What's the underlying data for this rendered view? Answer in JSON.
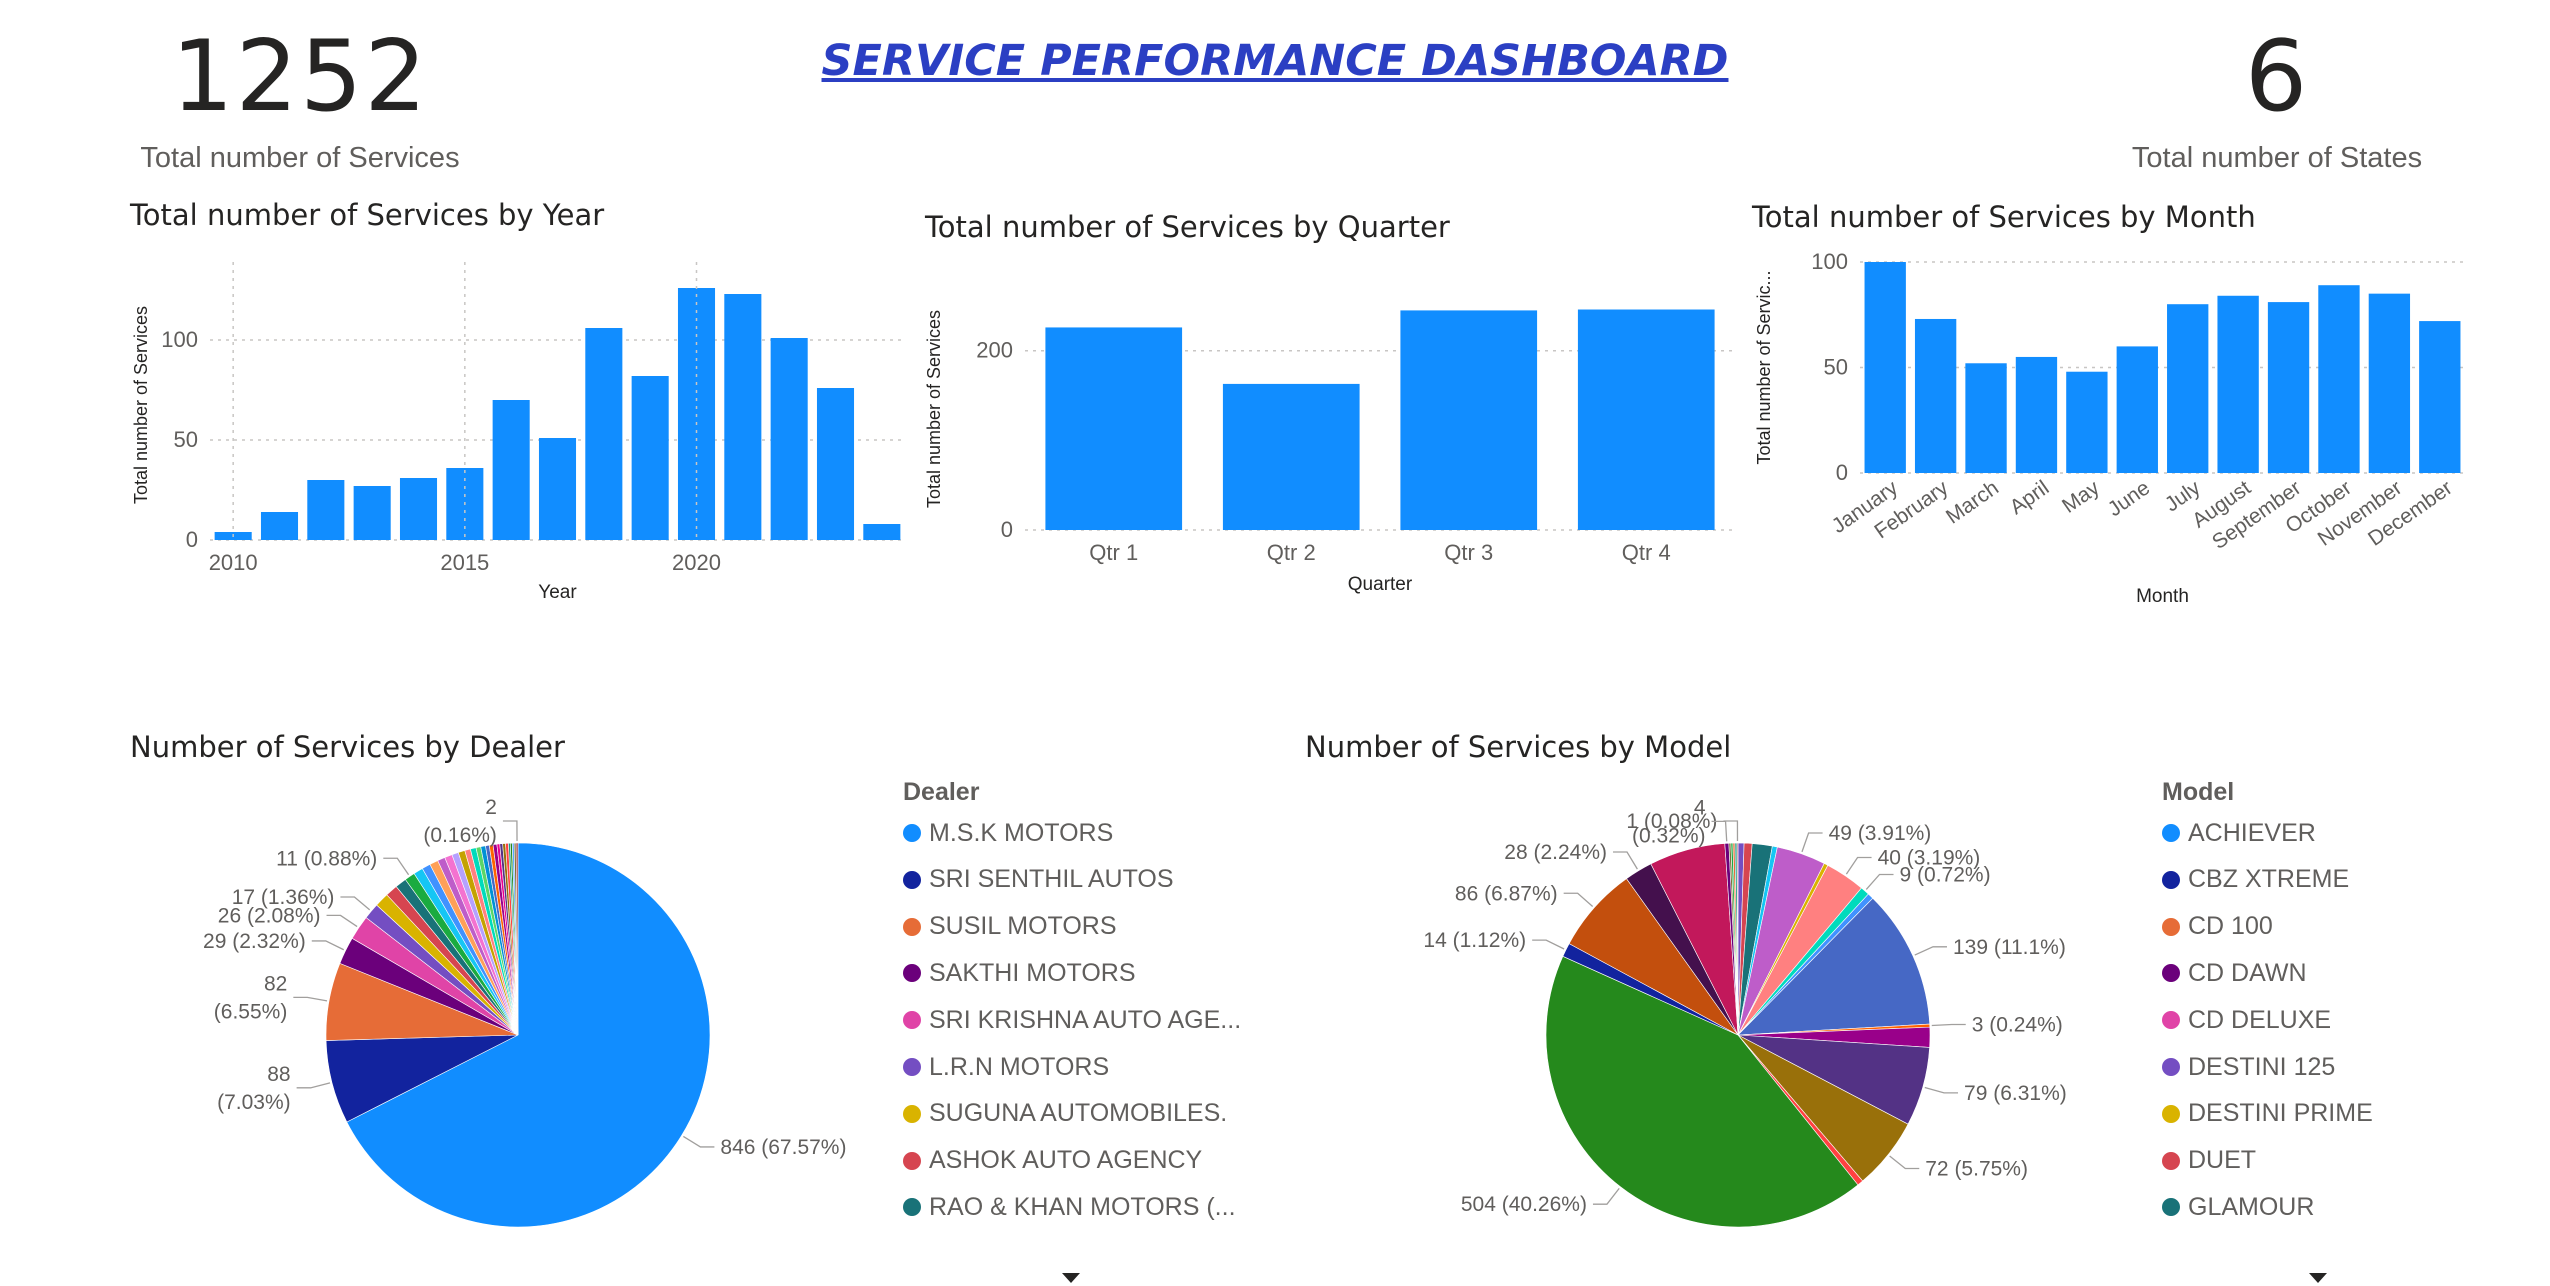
{
  "kpi_services": {
    "value": "1252",
    "label": "Total number of Services"
  },
  "kpi_states": {
    "value": "6",
    "label": "Total number of States"
  },
  "dashboard_title": "SERVICE PERFORMANCE DASHBOARD",
  "colors": {
    "bar": "#118dff",
    "grid": "#c8c6c4",
    "axis_text": "#605e5c",
    "title_blue": "#2b3fc3"
  },
  "chart_data": [
    {
      "id": "year",
      "type": "bar",
      "title": "Total number of Services by Year",
      "xlabel": "Year",
      "ylabel": "Total number of Services",
      "x": [
        2010,
        2011,
        2012,
        2013,
        2014,
        2015,
        2016,
        2017,
        2018,
        2019,
        2020,
        2021,
        2022,
        2023,
        2024
      ],
      "values": [
        4,
        14,
        30,
        27,
        31,
        36,
        70,
        51,
        106,
        82,
        126,
        123,
        101,
        76,
        8
      ],
      "x_ticks": [
        "2010",
        "2015",
        "2020"
      ],
      "y_ticks": [
        "0",
        "50",
        "100"
      ],
      "ylim": [
        0,
        135
      ],
      "grid": true
    },
    {
      "id": "quarter",
      "type": "bar",
      "title": "Total number of Services by Quarter",
      "xlabel": "Quarter",
      "ylabel": "Total number of Services",
      "categories": [
        "Qtr 1",
        "Qtr 2",
        "Qtr 3",
        "Qtr 4"
      ],
      "values": [
        226,
        163,
        245,
        246
      ],
      "y_ticks": [
        "0",
        "200"
      ],
      "ylim": [
        0,
        270
      ],
      "grid": true
    },
    {
      "id": "month",
      "type": "bar",
      "title": "Total number of Services by Month",
      "xlabel": "Month",
      "ylabel": "Total number of Servic...",
      "categories": [
        "January",
        "February",
        "March",
        "April",
        "May",
        "June",
        "July",
        "August",
        "September",
        "October",
        "November",
        "December"
      ],
      "values": [
        100,
        73,
        52,
        55,
        48,
        60,
        80,
        84,
        81,
        89,
        85,
        72
      ],
      "y_ticks": [
        "0",
        "50",
        "100"
      ],
      "ylim": [
        0,
        100
      ],
      "grid": true
    },
    {
      "id": "dealer",
      "type": "pie",
      "title": "Number of Services by Dealer",
      "legend_title": "Dealer",
      "legend_position": "right",
      "legend": [
        {
          "name": "M.S.K MOTORS",
          "color": "#118dff"
        },
        {
          "name": "SRI SENTHIL AUTOS",
          "color": "#12239e"
        },
        {
          "name": "SUSIL MOTORS",
          "color": "#e66c37"
        },
        {
          "name": "SAKTHI MOTORS",
          "color": "#6b007b"
        },
        {
          "name": "SRI KRISHNA AUTO AGE...",
          "color": "#e044a7"
        },
        {
          "name": "L.R.N  MOTORS",
          "color": "#744ec2"
        },
        {
          "name": "SUGUNA AUTOMOBILES.",
          "color": "#d9b300"
        },
        {
          "name": "ASHOK AUTO AGENCY",
          "color": "#d64550"
        },
        {
          "name": "RAO & KHAN MOTORS (...",
          "color": "#197278"
        }
      ],
      "slices": [
        {
          "name": "M.S.K MOTORS",
          "value": 846,
          "color": "#118dff"
        },
        {
          "name": "SRI SENTHIL AUTOS",
          "value": 88,
          "color": "#12239e"
        },
        {
          "name": "SUSIL MOTORS",
          "value": 82,
          "color": "#e66c37"
        },
        {
          "name": "SAKTHI MOTORS",
          "value": 29,
          "color": "#6b007b"
        },
        {
          "name": "SRI KRISHNA AUTO AGE...",
          "value": 26,
          "color": "#e044a7"
        },
        {
          "name": "L.R.N  MOTORS",
          "value": 17,
          "color": "#744ec2"
        },
        {
          "name": "SUGUNA AUTOMOBILES.",
          "value": 15,
          "color": "#d9b300"
        },
        {
          "name": "ASHOK AUTO AGENCY",
          "value": 13,
          "color": "#d64550"
        },
        {
          "name": "RAO & KHAN MOTORS (...",
          "value": 12,
          "color": "#197278"
        },
        {
          "name": "",
          "value": 11,
          "color": "#1aab40"
        },
        {
          "name": "",
          "value": 10,
          "color": "#15c6f4"
        },
        {
          "name": "",
          "value": 9,
          "color": "#4092ff"
        },
        {
          "name": "",
          "value": 9,
          "color": "#ffa058"
        },
        {
          "name": "",
          "value": 8,
          "color": "#be5dc9"
        },
        {
          "name": "",
          "value": 8,
          "color": "#f472d0"
        },
        {
          "name": "",
          "value": 7,
          "color": "#b5a1ff"
        },
        {
          "name": "",
          "value": 7,
          "color": "#c4a200"
        },
        {
          "name": "",
          "value": 6,
          "color": "#ff8080"
        },
        {
          "name": "",
          "value": 6,
          "color": "#00dbbc"
        },
        {
          "name": "",
          "value": 5,
          "color": "#5bd667"
        },
        {
          "name": "",
          "value": 5,
          "color": "#0091d5"
        },
        {
          "name": "",
          "value": 4,
          "color": "#4668c5"
        },
        {
          "name": "",
          "value": 4,
          "color": "#ff6300"
        },
        {
          "name": "",
          "value": 4,
          "color": "#99008a"
        },
        {
          "name": "",
          "value": 3,
          "color": "#ec008c"
        },
        {
          "name": "",
          "value": 3,
          "color": "#533285"
        },
        {
          "name": "",
          "value": 3,
          "color": "#99700a"
        },
        {
          "name": "",
          "value": 3,
          "color": "#ff4141"
        },
        {
          "name": "",
          "value": 2,
          "color": "#1f9a85"
        },
        {
          "name": "",
          "value": 2,
          "color": "#25891c"
        },
        {
          "name": "",
          "value": 2,
          "color": "#57a5ff"
        },
        {
          "name": "",
          "value": 2,
          "color": "#7e6f39"
        },
        {
          "name": "",
          "value": 2,
          "color": "#a1343c"
        }
      ],
      "data_labels": [
        {
          "slice": 0,
          "lines": [
            "846 (67.57%)"
          ]
        },
        {
          "slice": 1,
          "lines": [
            "88",
            "(7.03%)"
          ]
        },
        {
          "slice": 2,
          "lines": [
            "82",
            "(6.55%)"
          ]
        },
        {
          "slice": 3,
          "lines": [
            "29 (2.32%)"
          ]
        },
        {
          "slice": 4,
          "lines": [
            "26 (2.08%)"
          ]
        },
        {
          "slice": 5,
          "lines": [
            "17 (1.36%)"
          ]
        },
        {
          "slice": 9,
          "lines": [
            "11 (0.88%)"
          ]
        },
        {
          "slice": 32,
          "lines": [
            "2",
            "(0.16%)"
          ]
        }
      ]
    },
    {
      "id": "model",
      "type": "pie",
      "title": "Number of Services by Model",
      "legend_title": "Model",
      "legend_position": "right",
      "legend": [
        {
          "name": "ACHIEVER",
          "color": "#118dff"
        },
        {
          "name": "CBZ XTREME",
          "color": "#12239e"
        },
        {
          "name": "CD 100",
          "color": "#e66c37"
        },
        {
          "name": "CD DAWN",
          "color": "#6b007b"
        },
        {
          "name": "CD DELUXE",
          "color": "#e044a7"
        },
        {
          "name": "DESTINI 125",
          "color": "#744ec2"
        },
        {
          "name": "DESTINI PRIME",
          "color": "#d9b300"
        },
        {
          "name": "DUET",
          "color": "#d64550"
        },
        {
          "name": "GLAMOUR",
          "color": "#197278"
        }
      ],
      "slices": [
        {
          "value": 6,
          "color": "#744ec2"
        },
        {
          "value": 8,
          "color": "#d64550"
        },
        {
          "value": 20,
          "color": "#197278"
        },
        {
          "value": 5,
          "color": "#15c6f4"
        },
        {
          "value": 49,
          "color": "#be5dc9"
        },
        {
          "value": 4,
          "color": "#d9b300"
        },
        {
          "value": 40,
          "color": "#ff8080"
        },
        {
          "value": 9,
          "color": "#00dbbc"
        },
        {
          "value": 6,
          "color": "#4092ff"
        },
        {
          "value": 139,
          "color": "#4668c5"
        },
        {
          "value": 3,
          "color": "#ff6300"
        },
        {
          "value": 20,
          "color": "#99008a"
        },
        {
          "value": 79,
          "color": "#533285"
        },
        {
          "value": 72,
          "color": "#99700a"
        },
        {
          "value": 6,
          "color": "#ff4141"
        },
        {
          "value": 504,
          "color": "#25891c"
        },
        {
          "value": 14,
          "color": "#12239e"
        },
        {
          "value": 86,
          "color": "#c34f0d"
        },
        {
          "value": 28,
          "color": "#44104d"
        },
        {
          "value": 76,
          "color": "#c2185b"
        },
        {
          "value": 4,
          "color": "#6b007b"
        },
        {
          "value": 2,
          "color": "#7e6f39"
        },
        {
          "value": 2,
          "color": "#1aab40"
        },
        {
          "value": 2,
          "color": "#e66c37"
        },
        {
          "value": 2,
          "color": "#1f9a85"
        },
        {
          "value": 1,
          "color": "#a1343c"
        }
      ],
      "data_labels": [
        {
          "slice": 25,
          "lines": [
            "1 (0.08%)"
          ]
        },
        {
          "slice": 4,
          "lines": [
            "49 (3.91%)"
          ]
        },
        {
          "slice": 6,
          "lines": [
            "40 (3.19%)"
          ]
        },
        {
          "slice": 7,
          "lines": [
            "9 (0.72%)"
          ]
        },
        {
          "slice": 9,
          "lines": [
            "139 (11.1%)"
          ]
        },
        {
          "slice": 10,
          "lines": [
            "3 (0.24%)"
          ]
        },
        {
          "slice": 12,
          "lines": [
            "79 (6.31%)"
          ]
        },
        {
          "slice": 13,
          "lines": [
            "72 (5.75%)"
          ]
        },
        {
          "slice": 15,
          "lines": [
            "504 (40.26%)"
          ]
        },
        {
          "slice": 16,
          "lines": [
            "14 (1.12%)"
          ]
        },
        {
          "slice": 17,
          "lines": [
            "86 (6.87%)"
          ]
        },
        {
          "slice": 18,
          "lines": [
            "28 (2.24%)"
          ]
        },
        {
          "slice": 20,
          "lines": [
            "4",
            "(0.32%)"
          ]
        }
      ]
    }
  ]
}
